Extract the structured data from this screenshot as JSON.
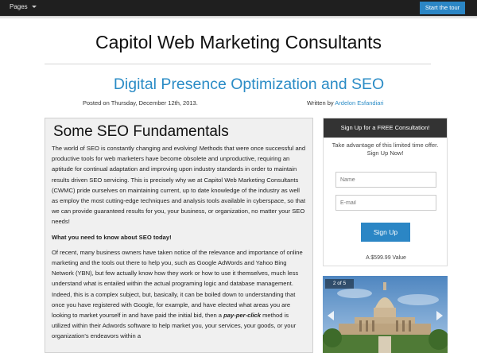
{
  "topbar": {
    "pages_label": "Pages",
    "tour_button": "Start the tour"
  },
  "site": {
    "title": "Capitol Web Marketing Consultants"
  },
  "post": {
    "title": "Digital Presence Optimization and SEO",
    "posted_on": "Posted on Thursday, December 12th, 2013.",
    "written_by_prefix": "Written by ",
    "author": "Ardelon Esfandiari"
  },
  "article": {
    "heading": "Some SEO Fundamentals",
    "paragraph1": "The world of SEO is constantly changing and evolving!  Methods that were once successful and productive tools for web marketers have become obsolete and unproductive, requiring an aptitude for continual adaptation and improving upon industry standards in order to maintain results driven SEO servicing.  This is precisely why we at Capitol Web Marketing Consultants (CWMC) pride ourselves on maintaining current, up to date knowledge of the industry as well as employ the most cutting-edge techniques and analysis tools available in cyberspace, so that we can provide guaranteed results for you, your business, or organization, no matter your SEO needs!",
    "subheading": "What you need to know about SEO today!",
    "paragraph2_before_bold": "Of recent, many business owners have taken notice of the relevance and importance of online marketing and the tools out there to help you, such as Google AdWords and Yahoo Bing Network (YBN), but few actually know how they work or how to use it themselves, much less understand what is entailed within the actual programing logic and database management.  Indeed, this is a complex subject, but, basically, it can be boiled down to understanding that once you have registered with Google, for example, and have elected what areas you are looking to market yourself in and have paid the initial bid, then a ",
    "paragraph2_bold": "pay-per-click",
    "paragraph2_after_bold": " method is utilized within their Adwords software to help market you, your services, your goods, or your organization's endeavors within a"
  },
  "signup": {
    "header": "Sign Up for a FREE Consultation!",
    "blurb": "Take advantage of this limited time offer. Sign Up Now!",
    "name_placeholder": "Name",
    "email_placeholder": "E-mail",
    "button": "Sign Up",
    "value_text": "A $599.99 Value"
  },
  "carousel": {
    "counter": "2 of 5",
    "image": "texas-capitol-building"
  },
  "colors": {
    "accent": "#2b86c5",
    "link": "#2b8cc6",
    "topbar": "#1f1f1f"
  }
}
